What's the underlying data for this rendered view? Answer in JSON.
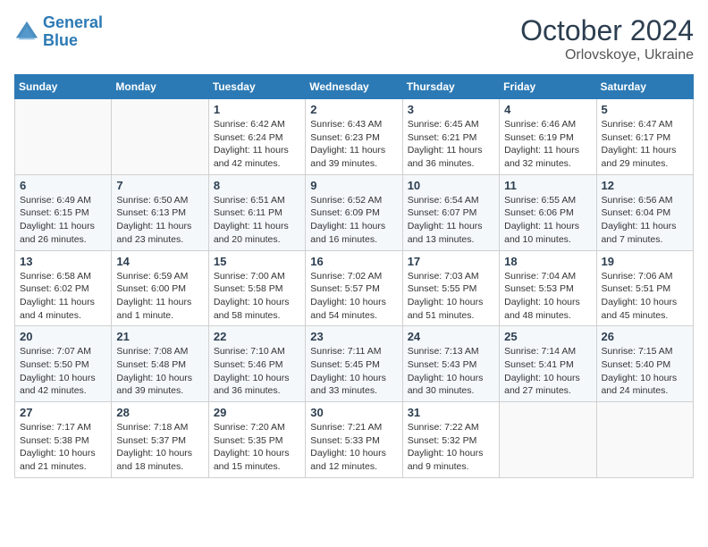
{
  "header": {
    "logo_line1": "General",
    "logo_line2": "Blue",
    "month": "October 2024",
    "location": "Orlovskoye, Ukraine"
  },
  "weekdays": [
    "Sunday",
    "Monday",
    "Tuesday",
    "Wednesday",
    "Thursday",
    "Friday",
    "Saturday"
  ],
  "weeks": [
    [
      {
        "day": "",
        "sunrise": "",
        "sunset": "",
        "daylight": ""
      },
      {
        "day": "",
        "sunrise": "",
        "sunset": "",
        "daylight": ""
      },
      {
        "day": "1",
        "sunrise": "Sunrise: 6:42 AM",
        "sunset": "Sunset: 6:24 PM",
        "daylight": "Daylight: 11 hours and 42 minutes."
      },
      {
        "day": "2",
        "sunrise": "Sunrise: 6:43 AM",
        "sunset": "Sunset: 6:23 PM",
        "daylight": "Daylight: 11 hours and 39 minutes."
      },
      {
        "day": "3",
        "sunrise": "Sunrise: 6:45 AM",
        "sunset": "Sunset: 6:21 PM",
        "daylight": "Daylight: 11 hours and 36 minutes."
      },
      {
        "day": "4",
        "sunrise": "Sunrise: 6:46 AM",
        "sunset": "Sunset: 6:19 PM",
        "daylight": "Daylight: 11 hours and 32 minutes."
      },
      {
        "day": "5",
        "sunrise": "Sunrise: 6:47 AM",
        "sunset": "Sunset: 6:17 PM",
        "daylight": "Daylight: 11 hours and 29 minutes."
      }
    ],
    [
      {
        "day": "6",
        "sunrise": "Sunrise: 6:49 AM",
        "sunset": "Sunset: 6:15 PM",
        "daylight": "Daylight: 11 hours and 26 minutes."
      },
      {
        "day": "7",
        "sunrise": "Sunrise: 6:50 AM",
        "sunset": "Sunset: 6:13 PM",
        "daylight": "Daylight: 11 hours and 23 minutes."
      },
      {
        "day": "8",
        "sunrise": "Sunrise: 6:51 AM",
        "sunset": "Sunset: 6:11 PM",
        "daylight": "Daylight: 11 hours and 20 minutes."
      },
      {
        "day": "9",
        "sunrise": "Sunrise: 6:52 AM",
        "sunset": "Sunset: 6:09 PM",
        "daylight": "Daylight: 11 hours and 16 minutes."
      },
      {
        "day": "10",
        "sunrise": "Sunrise: 6:54 AM",
        "sunset": "Sunset: 6:07 PM",
        "daylight": "Daylight: 11 hours and 13 minutes."
      },
      {
        "day": "11",
        "sunrise": "Sunrise: 6:55 AM",
        "sunset": "Sunset: 6:06 PM",
        "daylight": "Daylight: 11 hours and 10 minutes."
      },
      {
        "day": "12",
        "sunrise": "Sunrise: 6:56 AM",
        "sunset": "Sunset: 6:04 PM",
        "daylight": "Daylight: 11 hours and 7 minutes."
      }
    ],
    [
      {
        "day": "13",
        "sunrise": "Sunrise: 6:58 AM",
        "sunset": "Sunset: 6:02 PM",
        "daylight": "Daylight: 11 hours and 4 minutes."
      },
      {
        "day": "14",
        "sunrise": "Sunrise: 6:59 AM",
        "sunset": "Sunset: 6:00 PM",
        "daylight": "Daylight: 11 hours and 1 minute."
      },
      {
        "day": "15",
        "sunrise": "Sunrise: 7:00 AM",
        "sunset": "Sunset: 5:58 PM",
        "daylight": "Daylight: 10 hours and 58 minutes."
      },
      {
        "day": "16",
        "sunrise": "Sunrise: 7:02 AM",
        "sunset": "Sunset: 5:57 PM",
        "daylight": "Daylight: 10 hours and 54 minutes."
      },
      {
        "day": "17",
        "sunrise": "Sunrise: 7:03 AM",
        "sunset": "Sunset: 5:55 PM",
        "daylight": "Daylight: 10 hours and 51 minutes."
      },
      {
        "day": "18",
        "sunrise": "Sunrise: 7:04 AM",
        "sunset": "Sunset: 5:53 PM",
        "daylight": "Daylight: 10 hours and 48 minutes."
      },
      {
        "day": "19",
        "sunrise": "Sunrise: 7:06 AM",
        "sunset": "Sunset: 5:51 PM",
        "daylight": "Daylight: 10 hours and 45 minutes."
      }
    ],
    [
      {
        "day": "20",
        "sunrise": "Sunrise: 7:07 AM",
        "sunset": "Sunset: 5:50 PM",
        "daylight": "Daylight: 10 hours and 42 minutes."
      },
      {
        "day": "21",
        "sunrise": "Sunrise: 7:08 AM",
        "sunset": "Sunset: 5:48 PM",
        "daylight": "Daylight: 10 hours and 39 minutes."
      },
      {
        "day": "22",
        "sunrise": "Sunrise: 7:10 AM",
        "sunset": "Sunset: 5:46 PM",
        "daylight": "Daylight: 10 hours and 36 minutes."
      },
      {
        "day": "23",
        "sunrise": "Sunrise: 7:11 AM",
        "sunset": "Sunset: 5:45 PM",
        "daylight": "Daylight: 10 hours and 33 minutes."
      },
      {
        "day": "24",
        "sunrise": "Sunrise: 7:13 AM",
        "sunset": "Sunset: 5:43 PM",
        "daylight": "Daylight: 10 hours and 30 minutes."
      },
      {
        "day": "25",
        "sunrise": "Sunrise: 7:14 AM",
        "sunset": "Sunset: 5:41 PM",
        "daylight": "Daylight: 10 hours and 27 minutes."
      },
      {
        "day": "26",
        "sunrise": "Sunrise: 7:15 AM",
        "sunset": "Sunset: 5:40 PM",
        "daylight": "Daylight: 10 hours and 24 minutes."
      }
    ],
    [
      {
        "day": "27",
        "sunrise": "Sunrise: 7:17 AM",
        "sunset": "Sunset: 5:38 PM",
        "daylight": "Daylight: 10 hours and 21 minutes."
      },
      {
        "day": "28",
        "sunrise": "Sunrise: 7:18 AM",
        "sunset": "Sunset: 5:37 PM",
        "daylight": "Daylight: 10 hours and 18 minutes."
      },
      {
        "day": "29",
        "sunrise": "Sunrise: 7:20 AM",
        "sunset": "Sunset: 5:35 PM",
        "daylight": "Daylight: 10 hours and 15 minutes."
      },
      {
        "day": "30",
        "sunrise": "Sunrise: 7:21 AM",
        "sunset": "Sunset: 5:33 PM",
        "daylight": "Daylight: 10 hours and 12 minutes."
      },
      {
        "day": "31",
        "sunrise": "Sunrise: 7:22 AM",
        "sunset": "Sunset: 5:32 PM",
        "daylight": "Daylight: 10 hours and 9 minutes."
      },
      {
        "day": "",
        "sunrise": "",
        "sunset": "",
        "daylight": ""
      },
      {
        "day": "",
        "sunrise": "",
        "sunset": "",
        "daylight": ""
      }
    ]
  ]
}
